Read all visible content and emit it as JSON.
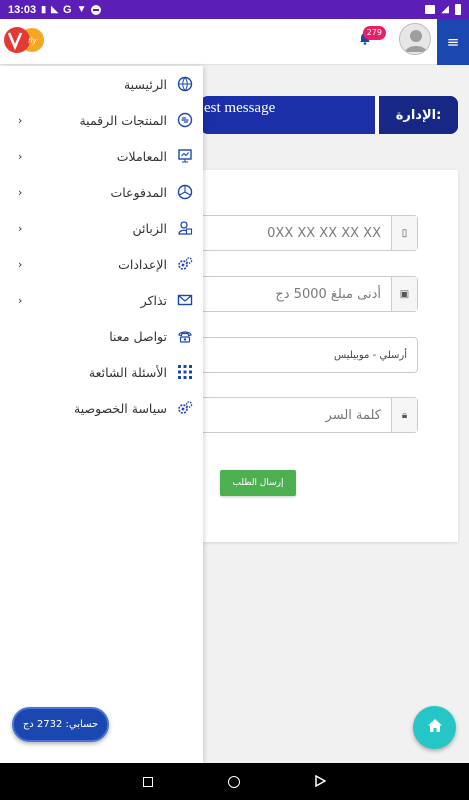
{
  "status_bar": {
    "time": "13:03",
    "carrier_letter": "G"
  },
  "header": {
    "notification_count": "279"
  },
  "announcement": {
    "message": "est message",
    "label": "الإدارة:"
  },
  "form": {
    "phone_placeholder": "0XX XX XX XX XX",
    "amount_placeholder": "أدنى مبلغ 5000 دج",
    "operator_value": "أرسلي - موبيليس",
    "password_placeholder": "كلمة السر",
    "submit_label": "إرسال الطلب"
  },
  "drawer": {
    "items": [
      {
        "label": "الرئيسية",
        "icon": "globe-icon",
        "has_children": false
      },
      {
        "label": "المنتجات الرقمية",
        "icon": "digital-products-icon",
        "has_children": true
      },
      {
        "label": "المعاملات",
        "icon": "transactions-icon",
        "has_children": true
      },
      {
        "label": "المدفوعات",
        "icon": "payments-icon",
        "has_children": true
      },
      {
        "label": "الزبائن",
        "icon": "customers-icon",
        "has_children": true
      },
      {
        "label": "الإعدادات",
        "icon": "settings-icon",
        "has_children": true
      },
      {
        "label": "تذاكر",
        "icon": "envelope-icon",
        "has_children": true
      },
      {
        "label": "تواصل معنا",
        "icon": "phone-icon",
        "has_children": false
      },
      {
        "label": "الأسئلة الشائعة",
        "icon": "grid-icon",
        "has_children": false
      },
      {
        "label": "سياسة الخصوصية",
        "icon": "privacy-icon",
        "has_children": false
      }
    ]
  },
  "balance": {
    "label": "حسابي: 2732 دج"
  },
  "colors": {
    "primary": "#1b47b0",
    "status_bar": "#5b1fb8",
    "success": "#4caf50",
    "fab": "#26c6c8",
    "badge": "#e91e63"
  }
}
